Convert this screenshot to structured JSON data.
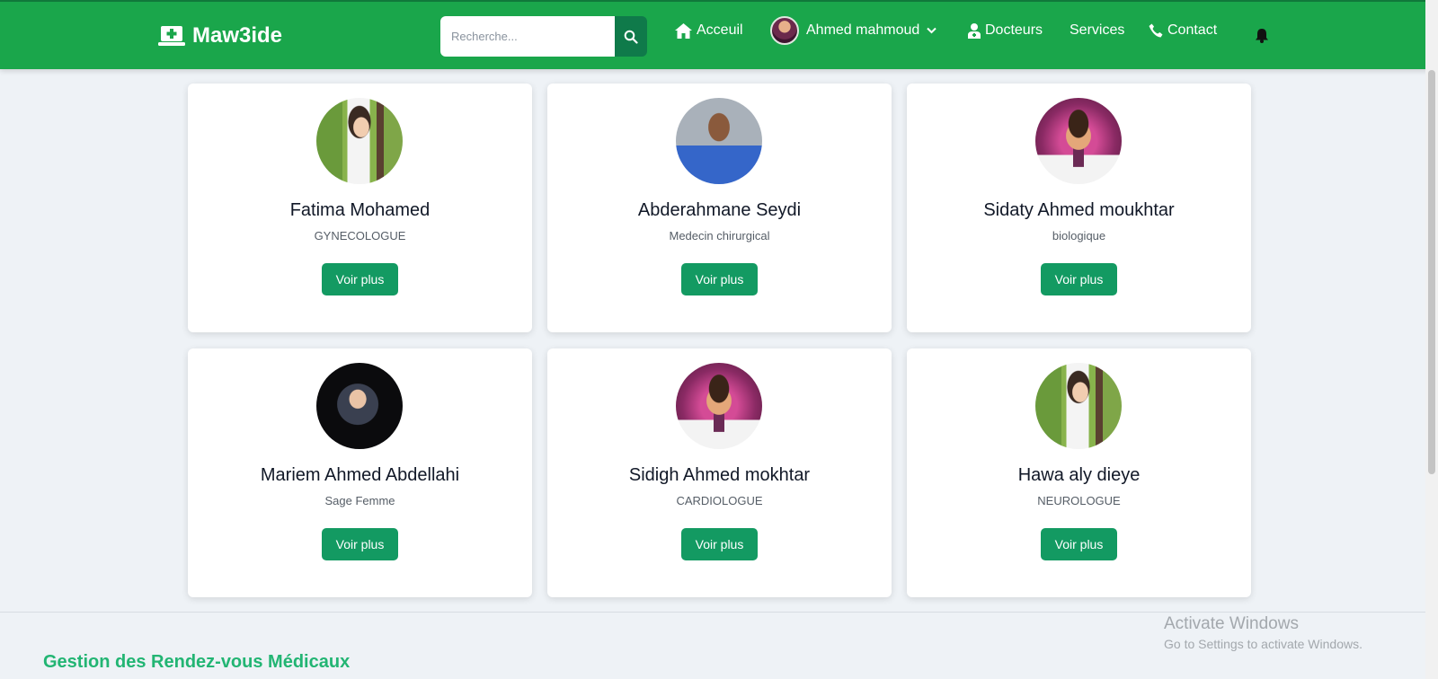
{
  "navbar": {
    "brand": "Maw3ide",
    "search_placeholder": "Recherche...",
    "home_label": "Acceuil",
    "user_name": "Ahmed mahmoud",
    "doctors_label": "Docteurs",
    "services_label": "Services",
    "contact_label": "Contact",
    "accent_color": "#1aa64b"
  },
  "doctors": [
    {
      "name": "Fatima Mohamed",
      "specialty": "GYNECOLOGUE",
      "button": "Voir plus",
      "avatar": "doctor-photo-forest"
    },
    {
      "name": "Abderahmane Seydi",
      "specialty": "Medecin chirurgical",
      "button": "Voir plus",
      "avatar": "doctor-photo-scrubs"
    },
    {
      "name": "Sidaty Ahmed moukhtar",
      "specialty": "biologique",
      "button": "Voir plus",
      "avatar": "doctor-cartoon"
    },
    {
      "name": "Mariem Ahmed Abdellahi",
      "specialty": "Sage Femme",
      "button": "Voir plus",
      "avatar": "doctor-photo-hijab"
    },
    {
      "name": "Sidigh Ahmed mokhtar",
      "specialty": "CARDIOLOGUE",
      "button": "Voir plus",
      "avatar": "doctor-cartoon"
    },
    {
      "name": "Hawa aly dieye",
      "specialty": "NEUROLOGUE",
      "button": "Voir plus",
      "avatar": "doctor-photo-forest"
    }
  ],
  "footer": {
    "title": "Gestion des Rendez-vous Médicaux"
  },
  "watermark": {
    "line1": "Activate Windows",
    "line2": "Go to Settings to activate Windows."
  },
  "colors": {
    "button": "#139a62",
    "footer_title": "#22b573"
  }
}
